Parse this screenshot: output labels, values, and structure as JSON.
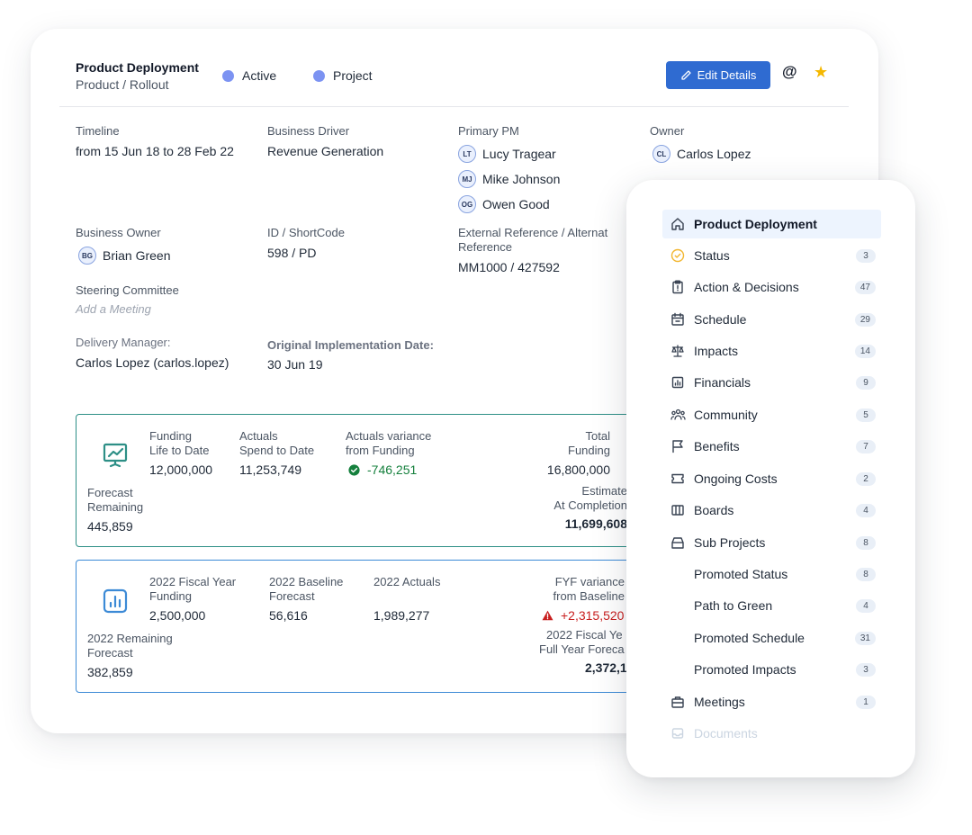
{
  "header": {
    "title": "Product Deployment",
    "subtitle": "Product / Rollout",
    "status_pills": [
      "Active",
      "Project"
    ],
    "edit_label": "Edit Details",
    "at_symbol": "@",
    "star_symbol": "★"
  },
  "details": {
    "timeline_label": "Timeline",
    "timeline_value": "from 15 Jun 18 to 28 Feb 22",
    "business_driver_label": "Business Driver",
    "business_driver_value": "Revenue Generation",
    "primary_pm_label": "Primary PM",
    "primary_pms": [
      {
        "initials": "LT",
        "name": "Lucy Tragear"
      },
      {
        "initials": "MJ",
        "name": "Mike Johnson"
      },
      {
        "initials": "OG",
        "name": "Owen Good"
      }
    ],
    "owner_label": "Owner",
    "owner": {
      "initials": "CL",
      "name": "Carlos Lopez"
    },
    "business_owner_label": "Business Owner",
    "business_owner": {
      "initials": "BG",
      "name": "Brian Green"
    },
    "id_label": "ID / ShortCode",
    "id_value": "598 / PD",
    "ext_ref_label_line1": "External Reference / Alternat",
    "ext_ref_label_line2": "Reference",
    "ext_ref_value": "MM1000 / 427592",
    "steering_label": "Steering Committee",
    "steering_placeholder": "Add a Meeting",
    "delivery_manager_label": "Delivery Manager:",
    "delivery_manager_value": "Carlos Lopez (carlos.lopez)",
    "orig_impl_label": "Original Implementation Date:",
    "orig_impl_value": "30 Jun 19"
  },
  "funding_box": {
    "funding_label_1": "Funding",
    "funding_label_2": "Life to Date",
    "funding_value": "12,000,000",
    "actuals_label_1": "Actuals",
    "actuals_label_2": "Spend to Date",
    "actuals_value": "11,253,749",
    "variance_label_1": "Actuals variance",
    "variance_label_2": "from Funding",
    "variance_value": "-746,251",
    "total_label_1": "Total",
    "total_label_2": "Funding",
    "total_value": "16,800,000",
    "forecast_label_1": "Forecast",
    "forecast_label_2": "Remaining",
    "forecast_value": "445,859",
    "estimate_label_1": "Estimate",
    "estimate_label_2": "At Completion",
    "estimate_value": "11,699,608"
  },
  "fiscal_box": {
    "fy_funding_label_1": "2022 Fiscal Year",
    "fy_funding_label_2": "Funding",
    "fy_funding_value": "2,500,000",
    "baseline_label_1": "2022 Baseline",
    "baseline_label_2": "Forecast",
    "baseline_value": "56,616",
    "actuals_label": "2022 Actuals",
    "actuals_value": "1,989,277",
    "fyf_label_1": "FYF variance",
    "fyf_label_2": "from Baseline",
    "fyf_value": "+2,315,520",
    "remaining_label_1": "2022 Remaining",
    "remaining_label_2": "Forecast",
    "remaining_value": "382,859",
    "fullyear_label_1": "2022 Fiscal Ye",
    "fullyear_label_2": "Full Year Foreca",
    "fullyear_value": "2,372,1"
  },
  "menu": {
    "items": [
      {
        "label": "Product Deployment",
        "icon": "home-icon"
      },
      {
        "label": "Status",
        "badge": "3",
        "icon": "check-circle-icon"
      },
      {
        "label": "Action & Decisions",
        "badge": "47",
        "icon": "clipboard-icon"
      },
      {
        "label": "Schedule",
        "badge": "29",
        "icon": "calendar-icon"
      },
      {
        "label": "Impacts",
        "badge": "14",
        "icon": "scale-icon"
      },
      {
        "label": "Financials",
        "badge": "9",
        "icon": "bar-chart-icon"
      },
      {
        "label": "Community",
        "badge": "5",
        "icon": "people-icon"
      },
      {
        "label": "Benefits",
        "badge": "7",
        "icon": "flag-icon"
      },
      {
        "label": "Ongoing Costs",
        "badge": "2",
        "icon": "ticket-icon"
      },
      {
        "label": "Boards",
        "badge": "4",
        "icon": "columns-icon"
      },
      {
        "label": "Sub Projects",
        "badge": "8",
        "icon": "stack-icon"
      },
      {
        "label": "Promoted Status",
        "badge": "8"
      },
      {
        "label": "Path to Green",
        "badge": "4"
      },
      {
        "label": "Promoted Schedule",
        "badge": "31"
      },
      {
        "label": "Promoted Impacts",
        "badge": "3"
      },
      {
        "label": "Meetings",
        "badge": "1",
        "icon": "briefcase-icon"
      },
      {
        "label": "Documents",
        "icon": "tray-icon"
      }
    ]
  },
  "colors": {
    "accent": "#2f6bd1",
    "pill_dot": "#7c93f2",
    "teal_border": "#2d8f86",
    "blue_border": "#3c8ad6",
    "positive": "#15803d",
    "negative": "#c81e1e",
    "star": "#f5b800",
    "menu_active_bg": "#edf4fe"
  }
}
